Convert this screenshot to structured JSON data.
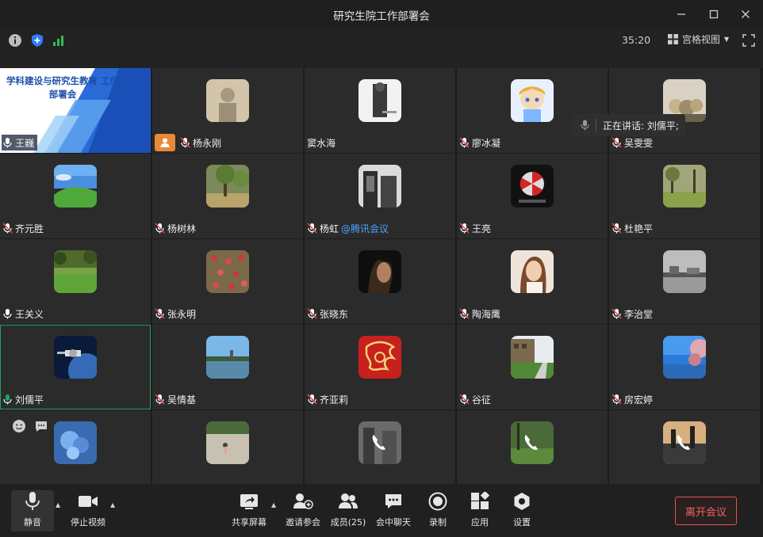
{
  "window": {
    "title": "研究生院工作部署会"
  },
  "infobar": {
    "timer": "35:20",
    "view_mode": "宫格视图"
  },
  "presentation": {
    "slide_title": "学科建设与研究生教育 工作部署会"
  },
  "speaking": {
    "label": "正在讲话: 刘儒平;"
  },
  "participants": [
    {
      "name": "王巍"
    },
    {
      "name": "杨永刚"
    },
    {
      "name": "窦水海"
    },
    {
      "name": "廖冰凝"
    },
    {
      "name": "吴雯雯"
    },
    {
      "name": "齐元胜"
    },
    {
      "name": "杨树林"
    },
    {
      "name": "杨虹",
      "suffix": "@腾讯会议"
    },
    {
      "name": "王亮"
    },
    {
      "name": "杜艳平"
    },
    {
      "name": "王关义"
    },
    {
      "name": "张永明"
    },
    {
      "name": "张晓东"
    },
    {
      "name": "陶海鹰"
    },
    {
      "name": "李治堂"
    },
    {
      "name": "刘儒平"
    },
    {
      "name": "吴情基"
    },
    {
      "name": "齐亚莉"
    },
    {
      "name": "谷征"
    },
    {
      "name": "房宏婷"
    }
  ],
  "toolbar": {
    "mute": "静音",
    "stop_video": "停止视频",
    "share_screen": "共享屏幕",
    "invite": "邀请参会",
    "members": "成员(25)",
    "chat": "会中聊天",
    "record": "录制",
    "apps": "应用",
    "settings": "设置",
    "leave": "离开会议"
  },
  "colors": {
    "accent_green": "#1fa463",
    "leave_red": "#e35252",
    "host_orange": "#e8893a",
    "link_blue": "#4aa3ff"
  }
}
